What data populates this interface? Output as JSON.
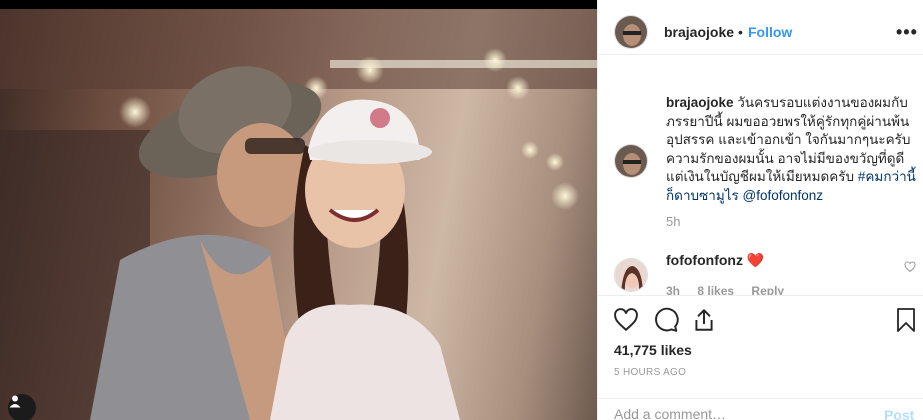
{
  "post": {
    "author": "brajaojoke",
    "follow_label": "Follow",
    "dot": "•",
    "more_label": "•••",
    "photo_alt": "couple photo"
  },
  "caption": {
    "username": "brajaojoke",
    "text": "วันครบรอบแต่งงานของผมกับภรรยาปีนี้ ผมขออวยพรให้คู่รักทุกคู่ผ่านพ้นอุปสรรค และเข้าอกเข้า ใจกันมากๆนะครับ ความรักของผมนั้น อาจไม่มีของขวัญที่ดูดี แต่เงินในบัญชีผมให้เมียหมดครับ",
    "hashtag": "#คมกว่านี้ก็ดาบซามูไร",
    "mention": "@fofofonfonz",
    "time": "5h"
  },
  "comment": {
    "username": "fofofonfonz",
    "heart": "❤️",
    "time": "3h",
    "likes": "8 likes",
    "reply": "Reply"
  },
  "stats": {
    "likes": "41,775 likes",
    "ago": "5 hours ago"
  },
  "add_comment": {
    "placeholder": "Add a comment…",
    "post_label": "Post"
  },
  "icons": {
    "like": "heart-outline-icon",
    "comment": "comment-bubble-icon",
    "share": "share-upload-icon",
    "save": "bookmark-icon",
    "user_tag": "user-tag-icon",
    "comment_like": "small-heart-icon"
  },
  "colors": {
    "link_blue": "#3897f0",
    "hashtag": "#003569",
    "muted": "#999999",
    "heart_red": "#ed4956"
  }
}
